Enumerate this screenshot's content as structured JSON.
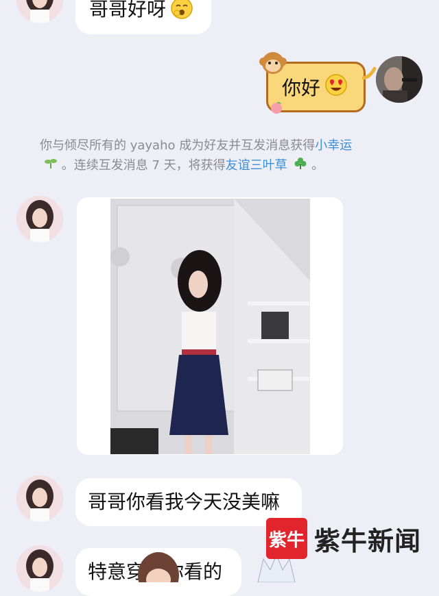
{
  "messages": {
    "msg1": {
      "text": "哥哥好呀",
      "emoji": "yawning-face-icon"
    },
    "msg_sent": {
      "text": "你好",
      "emoji": "heart-eyes-face-icon"
    },
    "system": {
      "part1": "你与倾尽所有的 yayaho 成为好友并互发消息获得",
      "link1": "小幸运",
      "part2": "。连续互发消息 7 天，将获得",
      "link2": "友谊三叶草",
      "part3": "。"
    },
    "msg_photo": {
      "alt": "photo"
    },
    "msg3": {
      "text": "哥哥你看我今天没美嘛"
    },
    "msg4": {
      "text": "特意穿给你看的"
    }
  },
  "watermark": {
    "logo_text": "紫牛",
    "text": "紫牛新闻"
  },
  "colors": {
    "background": "#eeeef6",
    "bubble": "#ffffff",
    "link": "#3d8fd6",
    "sent_bubble": "#f9d77a",
    "watermark_red": "#e2252c"
  }
}
